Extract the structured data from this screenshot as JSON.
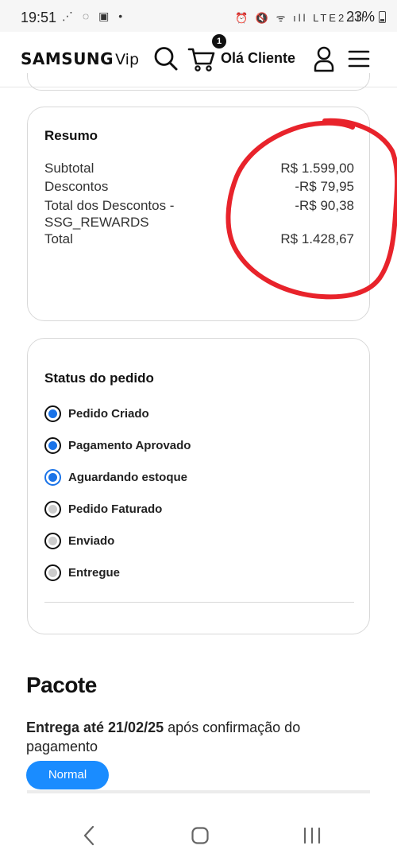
{
  "status_bar": {
    "time": "19:51",
    "left_icons": "⋰ ◌ ▣ •",
    "right_icons": "⏰ 🔇 ᯤ ıll LTE2 ıll",
    "battery": "23%"
  },
  "header": {
    "logo_brand": "SAMSUNG",
    "logo_sub": "Vip",
    "cart_count": "1",
    "greeting": "Olá Cliente"
  },
  "summary": {
    "title": "Resumo",
    "rows": [
      {
        "label": "Subtotal",
        "value": "R$ 1.599,00"
      },
      {
        "label": "Descontos",
        "value": "-R$ 79,95"
      },
      {
        "label": "Total dos Descontos - SSG_REWARDS",
        "value": "-R$ 90,38"
      },
      {
        "label": "Total",
        "value": "R$ 1.428,67"
      }
    ]
  },
  "order_status": {
    "title": "Status do pedido",
    "items": [
      {
        "label": "Pedido Criado",
        "state": "done"
      },
      {
        "label": "Pagamento Aprovado",
        "state": "done"
      },
      {
        "label": "Aguardando estoque",
        "state": "current"
      },
      {
        "label": "Pedido Faturado",
        "state": "pending"
      },
      {
        "label": "Enviado",
        "state": "pending"
      },
      {
        "label": "Entregue",
        "state": "pending"
      }
    ]
  },
  "package": {
    "title": "Pacote",
    "delivery_bold": "Entrega até 21/02/25",
    "delivery_rest": " após confirmação do pagamento",
    "shipping_button": "Normal"
  },
  "colors": {
    "accent": "#1a8cff",
    "radio_done": "#1a73e8",
    "radio_pending": "#cccccc",
    "annotation": "#e8232b"
  }
}
